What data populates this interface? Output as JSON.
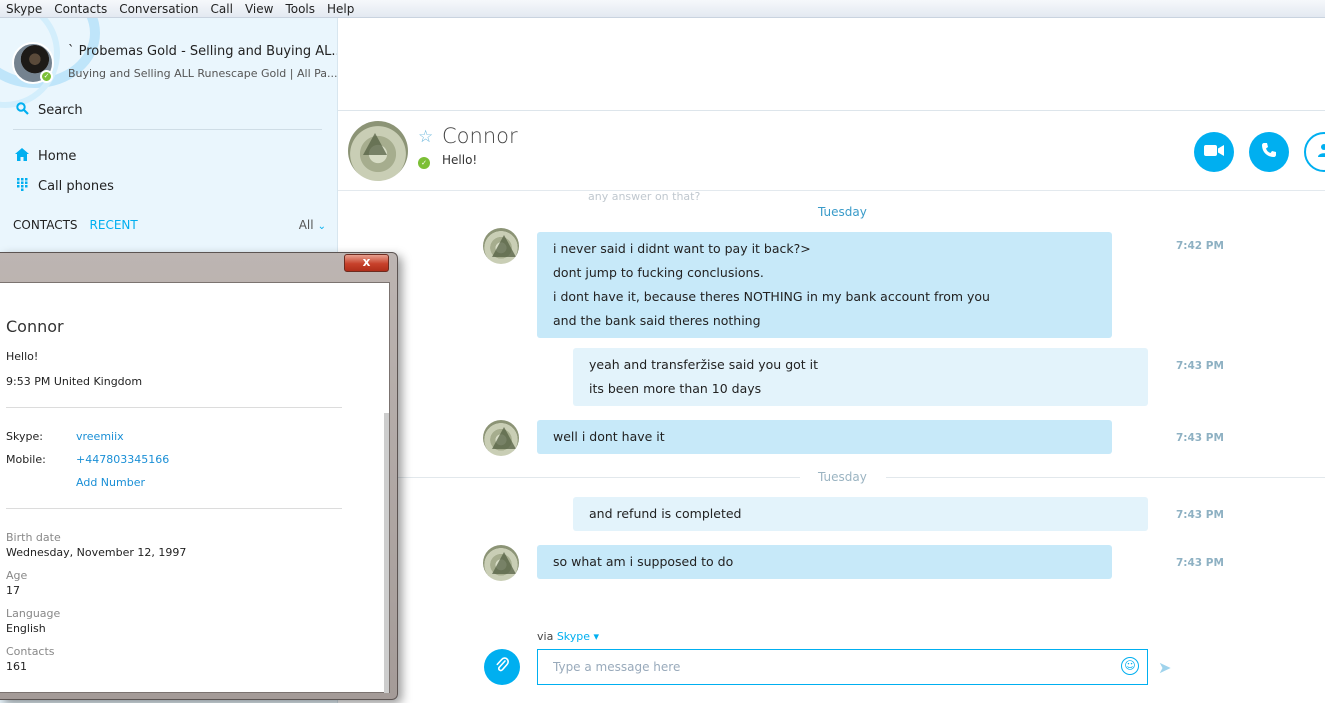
{
  "menu": [
    "Skype",
    "Contacts",
    "Conversation",
    "Call",
    "View",
    "Tools",
    "Help"
  ],
  "profile": {
    "name": "` Probemas Gold - Selling and Buying AL...",
    "mood": "Buying and Selling ALL Runescape Gold | All Pa..."
  },
  "sidebar": {
    "search_label": "Search",
    "home_label": "Home",
    "call_phones_label": "Call phones",
    "tab_contacts": "CONTACTS",
    "tab_recent": "RECENT",
    "filter_all": "All"
  },
  "conversation": {
    "contact_name": "Connor",
    "contact_mood": "Hello!",
    "faded_text": "any answer on that?",
    "day1": "Tuesday",
    "day2": "Tuesday",
    "messages": [
      {
        "dir": "in",
        "lines": [
          "i never said i didnt want to pay it back?>",
          "dont jump to fucking conclusions.",
          "i dont have it, because theres NOTHING in my bank account from you",
          "and the bank said theres nothing"
        ],
        "time": "7:42 PM"
      },
      {
        "dir": "out",
        "lines": [
          "yeah and transferžise said you got it",
          "its been more than 10 days"
        ],
        "time": "7:43 PM"
      },
      {
        "dir": "in",
        "lines": [
          "well i dont have it"
        ],
        "time": "7:43 PM"
      },
      {
        "dir": "out",
        "lines": [
          "and refund is completed"
        ],
        "time": "7:43 PM"
      },
      {
        "dir": "in",
        "lines": [
          "so what am i supposed to do"
        ],
        "time": "7:43 PM"
      }
    ],
    "via_prefix": "via",
    "via_service": "Skype",
    "input_placeholder": "Type a message here"
  },
  "popup": {
    "name": "Connor",
    "mood": "Hello!",
    "local_time": "9:53 PM United Kingdom",
    "skype_label": "Skype:",
    "skype_value": "vreemiix",
    "mobile_label": "Mobile:",
    "mobile_value": "+447803345166",
    "add_number": "Add Number",
    "birth_label": "Birth date",
    "birth_value": "Wednesday, November 12, 1997",
    "age_label": "Age",
    "age_value": "17",
    "language_label": "Language",
    "language_value": "English",
    "contacts_label": "Contacts",
    "contacts_value": "161",
    "close_glyph": "x"
  },
  "colors": {
    "accent": "#00aff0",
    "bubble_in": "#c7e9f9",
    "bubble_out": "#e3f3fb",
    "presence": "#7cbf36"
  },
  "icons": [
    "search-icon",
    "home-icon",
    "dialpad-icon",
    "star-icon",
    "video-call-icon",
    "phone-icon",
    "profile-icon",
    "paperclip-icon",
    "emoji-icon",
    "send-icon",
    "chevron-down-icon"
  ]
}
